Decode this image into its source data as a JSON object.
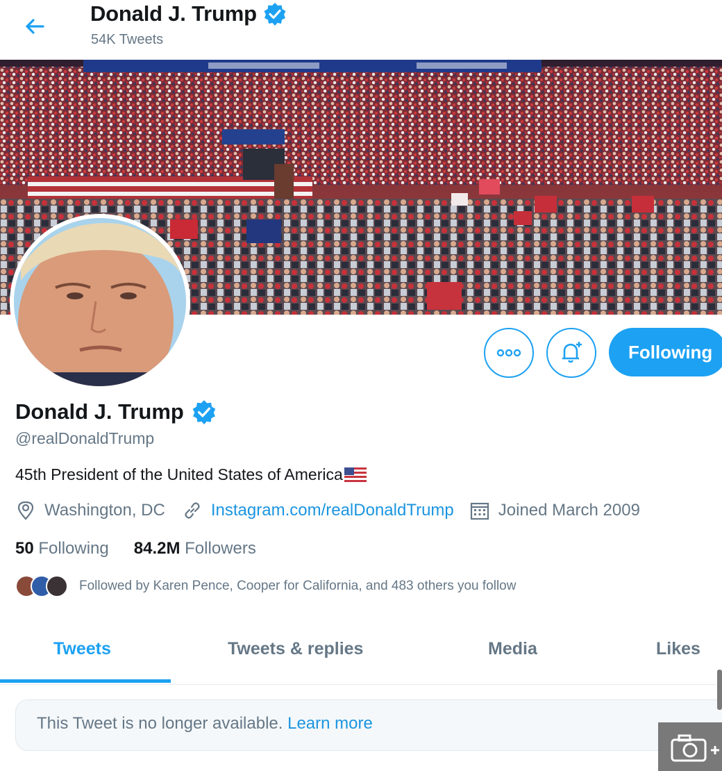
{
  "header": {
    "title": "Donald J. Trump",
    "tweet_count": "54K Tweets"
  },
  "profile": {
    "name": "Donald J. Trump",
    "handle": "@realDonaldTrump",
    "bio": "45th President of the United States of America",
    "location": "Washington, DC",
    "website": "Instagram.com/realDonaldTrump",
    "joined": "Joined March 2009",
    "following_count": "50",
    "following_label": "Following",
    "followers_count": "84.2M",
    "followers_label": "Followers",
    "followed_by": "Followed by Karen Pence, Cooper for California, and 483 others you follow"
  },
  "actions": {
    "follow_label": "Following"
  },
  "tabs": [
    {
      "label": "Tweets",
      "active": true
    },
    {
      "label": "Tweets & replies",
      "active": false
    },
    {
      "label": "Media",
      "active": false
    },
    {
      "label": "Likes",
      "active": false
    }
  ],
  "notice": {
    "text": "This Tweet is no longer available.",
    "link": "Learn more"
  },
  "colors": {
    "accent": "#1da1f2",
    "link": "#1b95e0",
    "secondary_text": "#657786"
  },
  "icons": [
    "back-arrow-icon",
    "verified-badge-icon",
    "more-icon",
    "notification-bell-icon",
    "location-pin-icon",
    "link-icon",
    "calendar-icon",
    "camera-icon"
  ]
}
